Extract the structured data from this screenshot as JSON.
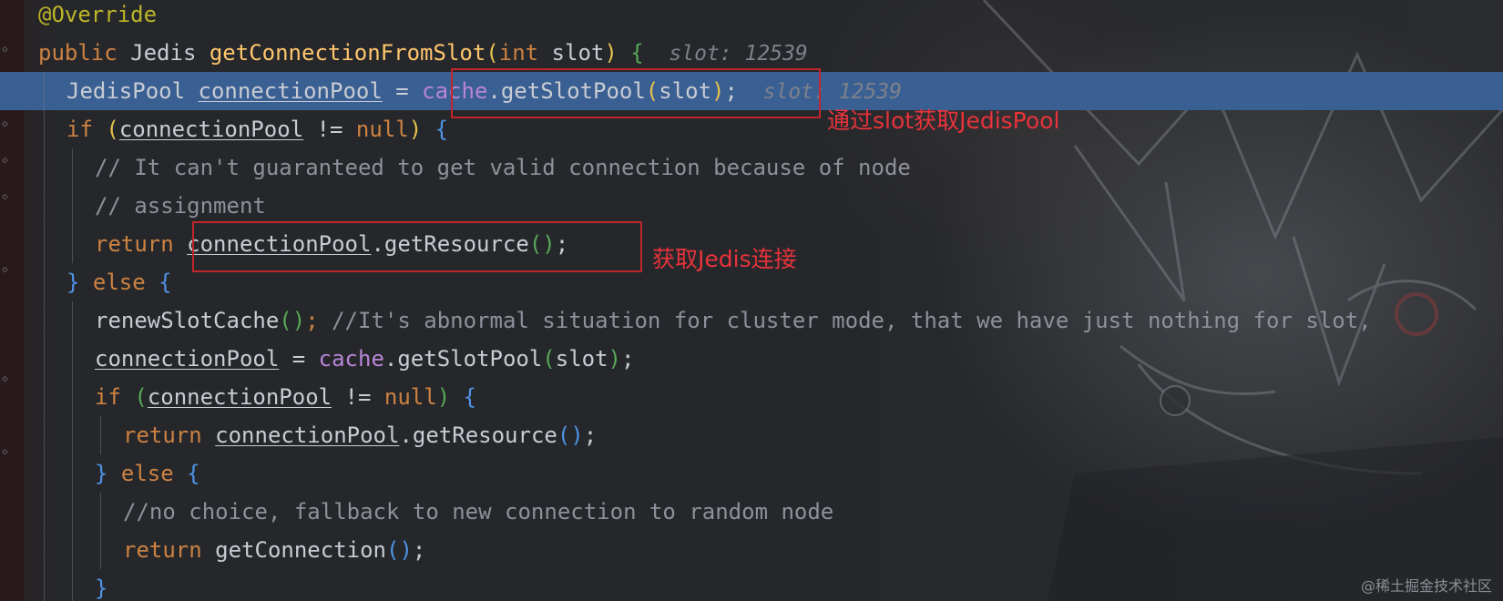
{
  "editor": {
    "lines": [
      {
        "id": "l1",
        "indent": 0,
        "tokens": [
          [
            "ann",
            "@Override"
          ]
        ]
      },
      {
        "id": "l2",
        "indent": 0,
        "tokens": [
          [
            "kw",
            "public "
          ],
          [
            "plain",
            "Jedis "
          ],
          [
            "fn",
            "getConnectionFromSlot"
          ],
          [
            "p1",
            "("
          ],
          [
            "kw",
            "int "
          ],
          [
            "plain",
            "slot"
          ],
          [
            "p1",
            ")"
          ],
          [
            "plain",
            " "
          ],
          [
            "p2",
            "{"
          ]
        ],
        "hint": "slot: 12539"
      },
      {
        "id": "l3",
        "indent": 1,
        "highlight": true,
        "tokens": [
          [
            "plain",
            "JedisPool "
          ],
          [
            "var",
            "connectionPool"
          ],
          [
            "plain",
            " = "
          ],
          [
            "field",
            "cache"
          ],
          [
            "plain",
            ".getSlotPool"
          ],
          [
            "p1",
            "("
          ],
          [
            "plain",
            "slot"
          ],
          [
            "p1",
            ")"
          ],
          [
            "plain",
            ";"
          ]
        ],
        "hint": "slot: 12539"
      },
      {
        "id": "l4",
        "indent": 1,
        "tokens": [
          [
            "kw",
            "if "
          ],
          [
            "p1",
            "("
          ],
          [
            "var",
            "connectionPool"
          ],
          [
            "plain",
            " != "
          ],
          [
            "kw",
            "null"
          ],
          [
            "p1",
            ")"
          ],
          [
            "plain",
            " "
          ],
          [
            "p3",
            "{"
          ]
        ]
      },
      {
        "id": "l5",
        "indent": 2,
        "tokens": [
          [
            "cmt",
            "// It can't guaranteed to get valid connection because of node"
          ]
        ]
      },
      {
        "id": "l6",
        "indent": 2,
        "tokens": [
          [
            "cmt",
            "// assignment"
          ]
        ]
      },
      {
        "id": "l7",
        "indent": 2,
        "tokens": [
          [
            "kw",
            "return "
          ],
          [
            "var",
            "connectionPool"
          ],
          [
            "plain",
            ".getResource"
          ],
          [
            "p2",
            "()"
          ],
          [
            "plain",
            ";"
          ]
        ]
      },
      {
        "id": "l8",
        "indent": 1,
        "tokens": [
          [
            "p3",
            "} "
          ],
          [
            "kw",
            "else "
          ],
          [
            "p3",
            "{"
          ]
        ]
      },
      {
        "id": "l9",
        "indent": 2,
        "tokens": [
          [
            "plain",
            "renewSlotCache"
          ],
          [
            "p2",
            "()"
          ],
          [
            "kw",
            "; "
          ],
          [
            "cmt",
            "//It's abnormal situation for cluster mode, that we have just nothing for slot,"
          ]
        ]
      },
      {
        "id": "l10",
        "indent": 2,
        "tokens": [
          [
            "var",
            "connectionPool"
          ],
          [
            "plain",
            " = "
          ],
          [
            "field",
            "cache"
          ],
          [
            "plain",
            ".getSlotPool"
          ],
          [
            "p2",
            "("
          ],
          [
            "plain",
            "slot"
          ],
          [
            "p2",
            ")"
          ],
          [
            "plain",
            ";"
          ]
        ]
      },
      {
        "id": "l11",
        "indent": 2,
        "tokens": [
          [
            "kw",
            "if "
          ],
          [
            "p2",
            "("
          ],
          [
            "var",
            "connectionPool"
          ],
          [
            "plain",
            " != "
          ],
          [
            "kw",
            "null"
          ],
          [
            "p2",
            ")"
          ],
          [
            "plain",
            " "
          ],
          [
            "p3",
            "{"
          ]
        ]
      },
      {
        "id": "l12",
        "indent": 3,
        "tokens": [
          [
            "kw",
            "return "
          ],
          [
            "var",
            "connectionPool"
          ],
          [
            "plain",
            ".getResource"
          ],
          [
            "p3",
            "()"
          ],
          [
            "plain",
            ";"
          ]
        ]
      },
      {
        "id": "l13",
        "indent": 2,
        "tokens": [
          [
            "p3",
            "} "
          ],
          [
            "kw",
            "else "
          ],
          [
            "p3",
            "{"
          ]
        ]
      },
      {
        "id": "l14",
        "indent": 3,
        "tokens": [
          [
            "cmt",
            "//no choice, fallback to new connection to random node"
          ]
        ]
      },
      {
        "id": "l15",
        "indent": 3,
        "tokens": [
          [
            "kw",
            "return "
          ],
          [
            "plain",
            "getConnection"
          ],
          [
            "p3",
            "()"
          ],
          [
            "plain",
            ";"
          ]
        ]
      },
      {
        "id": "l16",
        "indent": 2,
        "tokens": [
          [
            "p3",
            "}"
          ]
        ]
      }
    ]
  },
  "annotations": {
    "note1": "通过slot获取JedisPool",
    "note2": "获取Jedis连接"
  },
  "watermark": "@稀土掘金技术社区",
  "colors": {
    "keyword": "#cc8242",
    "annotation": "#bbb529",
    "method": "#ffc66d",
    "field": "#b785d6",
    "comment": "#8d919a",
    "highlight": "#3a5f93",
    "redbox": "#c0272d"
  }
}
